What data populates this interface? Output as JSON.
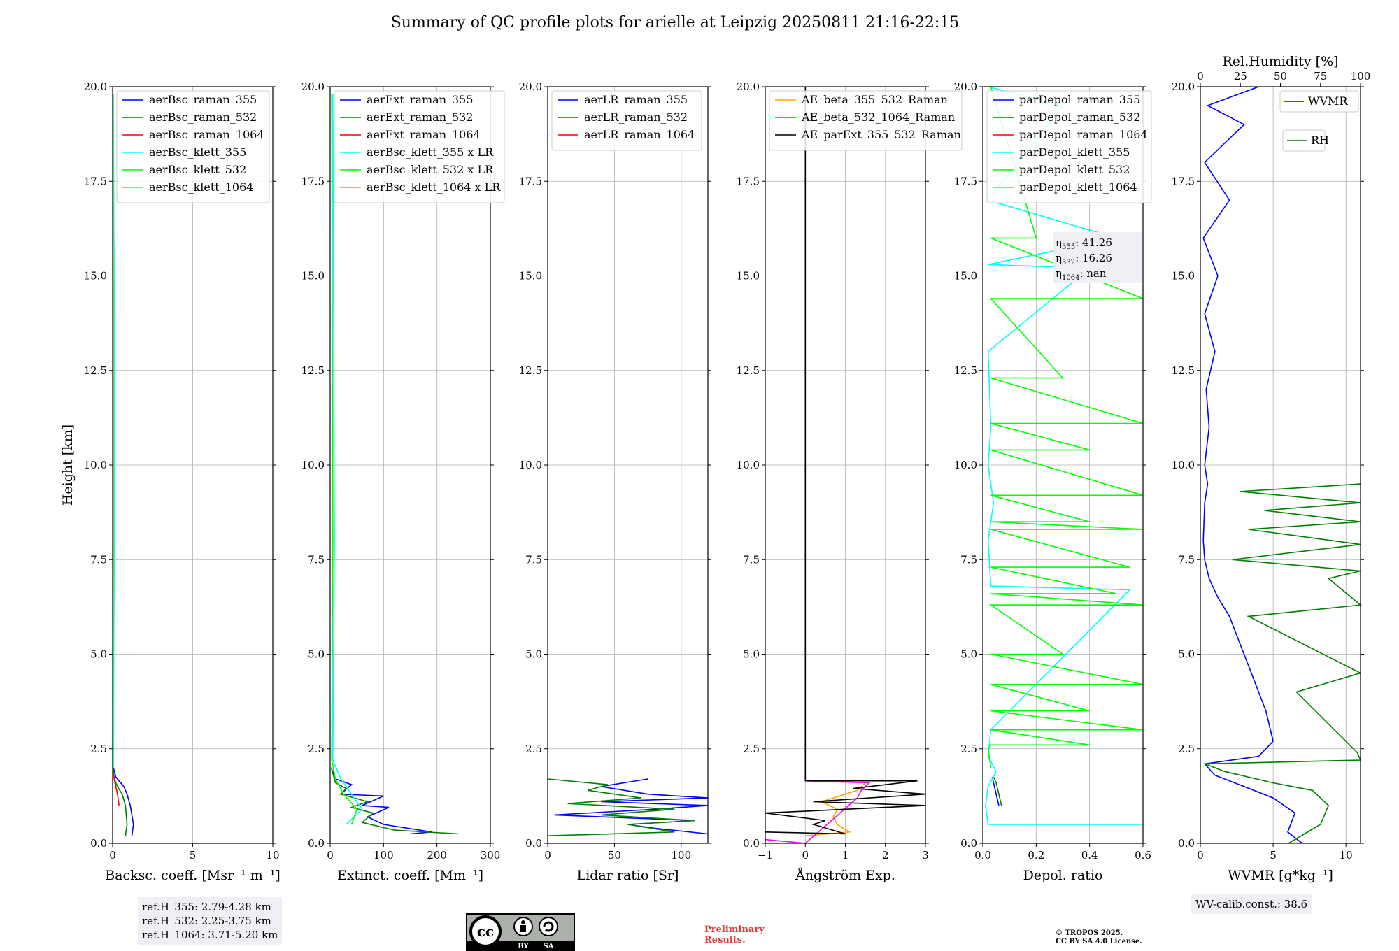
{
  "title": "Summary of QC profile plots for arielle at Leipzig 20250811 21:16-22:15",
  "ylabel": "Height [km]",
  "colors": {
    "blue": "#0000ff",
    "green": "#008000",
    "red": "#ff0000",
    "cyan": "#00ffff",
    "lime": "#00ff00",
    "salmon": "#fa8072",
    "orange": "#ffa500",
    "magenta": "#ff00ff",
    "black": "#000000"
  },
  "bottom_info": {
    "ref_lines": [
      "ref.H_355: 2.79-4.28 km",
      "ref.H_532: 2.25-3.75 km",
      "ref.H_1064: 3.71-5.20 km"
    ],
    "wv_calib": "WV-calib.const.: 38.6",
    "preliminary": [
      "Preliminary",
      "Results."
    ],
    "copyright": [
      "© TROPOS 2025.",
      "CC BY SA 4.0 License."
    ],
    "cc_badge": {
      "left": "BY",
      "right": "SA",
      "main": "cc"
    }
  },
  "chart_data": [
    {
      "type": "line",
      "xlabel": "Backsc. coeff. [Msr⁻¹ m⁻¹]",
      "xlim": [
        0,
        10
      ],
      "ylim": [
        0,
        20
      ],
      "xticks": [
        0,
        5,
        10
      ],
      "xticklabels": [
        "0",
        "5",
        "10"
      ],
      "yticks": [
        0,
        2.5,
        5,
        7.5,
        10,
        12.5,
        15,
        17.5,
        20
      ],
      "yticklabels": [
        "0.0",
        "2.5",
        "5.0",
        "7.5",
        "10.0",
        "12.5",
        "15.0",
        "17.5",
        "20.0"
      ],
      "legend": [
        {
          "name": "aerBsc_raman_355",
          "color": "#0000ff"
        },
        {
          "name": "aerBsc_raman_532",
          "color": "#008000"
        },
        {
          "name": "aerBsc_raman_1064",
          "color": "#ff0000"
        },
        {
          "name": "aerBsc_klett_355",
          "color": "#00ffff"
        },
        {
          "name": "aerBsc_klett_532",
          "color": "#00ff00"
        },
        {
          "name": "aerBsc_klett_1064",
          "color": "#fa8072"
        }
      ],
      "series": [
        {
          "name": "aerBsc_raman_355",
          "color": "#0000ff",
          "x": [
            1.2,
            1.3,
            1.1,
            0.9,
            0.7,
            0.2,
            0.05
          ],
          "y": [
            0.2,
            0.5,
            1.0,
            1.3,
            1.5,
            1.75,
            2.0
          ]
        },
        {
          "name": "aerBsc_raman_532",
          "color": "#008000",
          "x": [
            0.8,
            0.9,
            0.8,
            0.6,
            0.3,
            0.1,
            0.02
          ],
          "y": [
            0.2,
            0.5,
            1.0,
            1.3,
            1.5,
            1.7,
            2.0
          ]
        },
        {
          "name": "aerBsc_raman_1064",
          "color": "#ff0000",
          "x": [
            0.4,
            0.3,
            0.15,
            0.05
          ],
          "y": [
            1.0,
            1.3,
            1.6,
            1.8
          ]
        },
        {
          "name": "aerBsc_klett_355",
          "color": "#00ffff",
          "x": [
            0.05,
            0.1,
            0.1,
            0.05
          ],
          "y": [
            2.0,
            8.0,
            14.0,
            19.8
          ]
        },
        {
          "name": "aerBsc_klett_532",
          "color": "#00ff00",
          "x": [
            0.02,
            0.05,
            0.05,
            0.03
          ],
          "y": [
            2.0,
            8.0,
            14.0,
            19.8
          ]
        },
        {
          "name": "aerBsc_klett_1064",
          "color": "#fa8072",
          "x": [
            0.01,
            0.03,
            0.03,
            0.02
          ],
          "y": [
            2.0,
            8.0,
            14.0,
            19.8
          ]
        }
      ]
    },
    {
      "type": "line",
      "xlabel": "Extinct. coeff. [Mm⁻¹]",
      "xlim": [
        0,
        300
      ],
      "ylim": [
        0,
        20
      ],
      "xticks": [
        0,
        100,
        200,
        300
      ],
      "xticklabels": [
        "0",
        "100",
        "200",
        "300"
      ],
      "yticks": [
        0,
        2.5,
        5,
        7.5,
        10,
        12.5,
        15,
        17.5,
        20
      ],
      "yticklabels": [
        "0.0",
        "2.5",
        "5.0",
        "7.5",
        "10.0",
        "12.5",
        "15.0",
        "17.5",
        "20.0"
      ],
      "legend": [
        {
          "name": "aerExt_raman_355",
          "color": "#0000ff"
        },
        {
          "name": "aerExt_raman_532",
          "color": "#008000"
        },
        {
          "name": "aerExt_raman_1064",
          "color": "#ff0000"
        },
        {
          "name": "aerBsc_klett_355 x LR",
          "color": "#00ffff"
        },
        {
          "name": "aerBsc_klett_532 x LR",
          "color": "#00ff00"
        },
        {
          "name": "aerBsc_klett_1064 x LR",
          "color": "#fa8072"
        }
      ],
      "series": [
        {
          "name": "aerExt_raman_355",
          "color": "#0000ff",
          "x": [
            150,
            190,
            100,
            70,
            110,
            60,
            100,
            20,
            40,
            10,
            2
          ],
          "y": [
            0.25,
            0.3,
            0.5,
            0.7,
            0.95,
            1.0,
            1.25,
            1.3,
            1.55,
            1.7,
            2.0
          ]
        },
        {
          "name": "aerExt_raman_532",
          "color": "#008000",
          "x": [
            240,
            120,
            60,
            80,
            40,
            70,
            20,
            30,
            10,
            2
          ],
          "y": [
            0.25,
            0.35,
            0.55,
            0.8,
            0.95,
            1.1,
            1.3,
            1.45,
            1.6,
            2.0
          ]
        },
        {
          "name": "aerBsc_klett_355 x LR",
          "color": "#00ffff",
          "x": [
            30,
            60,
            40,
            20,
            5,
            8,
            5
          ],
          "y": [
            0.5,
            0.9,
            1.3,
            1.7,
            2.2,
            8.0,
            19.8
          ]
        },
        {
          "name": "aerBsc_klett_532 x LR",
          "color": "#00ff00",
          "x": [
            40,
            50,
            25,
            10,
            3,
            5,
            3
          ],
          "y": [
            0.5,
            0.9,
            1.3,
            1.7,
            2.2,
            8.0,
            19.8
          ]
        }
      ]
    },
    {
      "type": "line",
      "xlabel": "Lidar ratio [Sr]",
      "xlim": [
        0,
        120
      ],
      "ylim": [
        0,
        20
      ],
      "xticks": [
        0,
        50,
        100
      ],
      "xticklabels": [
        "0",
        "50",
        "100"
      ],
      "yticks": [
        0,
        2.5,
        5,
        7.5,
        10,
        12.5,
        15,
        17.5,
        20
      ],
      "yticklabels": [
        "0.0",
        "2.5",
        "5.0",
        "7.5",
        "10.0",
        "12.5",
        "15.0",
        "17.5",
        "20.0"
      ],
      "legend": [
        {
          "name": "aerLR_raman_355",
          "color": "#0000ff"
        },
        {
          "name": "aerLR_raman_532",
          "color": "#008000"
        },
        {
          "name": "aerLR_raman_1064",
          "color": "#ff0000"
        }
      ],
      "series": [
        {
          "name": "aerLR_raman_355",
          "color": "#0000ff",
          "x": [
            120,
            80,
            60,
            110,
            5,
            80,
            120,
            40,
            120,
            75,
            40,
            75
          ],
          "y": [
            0.25,
            0.4,
            0.5,
            0.6,
            0.75,
            0.9,
            1.0,
            1.1,
            1.2,
            1.3,
            1.5,
            1.7
          ]
        },
        {
          "name": "aerLR_raman_532",
          "color": "#008000",
          "x": [
            0,
            95,
            60,
            110,
            40,
            95,
            15,
            70,
            30,
            45,
            0
          ],
          "y": [
            0.2,
            0.3,
            0.5,
            0.6,
            0.75,
            0.9,
            1.05,
            1.2,
            1.4,
            1.55,
            1.7
          ]
        }
      ]
    },
    {
      "type": "line",
      "xlabel": "Ångström Exp.",
      "xlim": [
        -1,
        3
      ],
      "ylim": [
        0,
        20
      ],
      "xticks": [
        -1,
        0,
        1,
        2,
        3
      ],
      "xticklabels": [
        "−1",
        "0",
        "1",
        "2",
        "3"
      ],
      "yticks": [
        0,
        2.5,
        5,
        7.5,
        10,
        12.5,
        15,
        17.5,
        20
      ],
      "yticklabels": [
        "0.0",
        "2.5",
        "5.0",
        "7.5",
        "10.0",
        "12.5",
        "15.0",
        "17.5",
        "20.0"
      ],
      "legend": [
        {
          "name": "AE_beta_355_532_Raman",
          "color": "#ffa500"
        },
        {
          "name": "AE_beta_532_1064_Raman",
          "color": "#ff00ff"
        },
        {
          "name": "AE_parExt_355_532_Raman",
          "color": "#000000"
        }
      ],
      "series": [
        {
          "name": "AE_beta_355_532_Raman",
          "color": "#ffa500",
          "x": [
            0,
            1.1,
            0.8,
            0.7,
            0.8,
            0.4,
            1.0,
            1.3,
            1.5,
            0
          ],
          "y": [
            0.2,
            0.3,
            0.5,
            0.7,
            0.9,
            1.1,
            1.3,
            1.4,
            1.6,
            1.65
          ]
        },
        {
          "name": "AE_beta_532_1064_Raman",
          "color": "#ff00ff",
          "x": [
            -1,
            0,
            0,
            1.3,
            1.4,
            1.6,
            0,
            0
          ],
          "y": [
            0.1,
            0.0,
            0.0,
            1.2,
            1.4,
            1.6,
            1.65,
            20.0
          ]
        },
        {
          "name": "AE_parExt_355_532_Raman",
          "color": "#000000",
          "x": [
            -1,
            1.0,
            0.2,
            0.5,
            -1,
            3.0,
            0.2,
            3.0,
            1.2,
            2.8,
            0,
            0
          ],
          "y": [
            0.3,
            0.25,
            0.5,
            0.6,
            0.8,
            1.0,
            1.1,
            1.3,
            1.45,
            1.65,
            1.65,
            20.0
          ]
        }
      ]
    },
    {
      "type": "line",
      "xlabel": "Depol. ratio",
      "xlim": [
        0,
        0.6
      ],
      "ylim": [
        0,
        20
      ],
      "xticks": [
        0,
        0.2,
        0.4,
        0.6
      ],
      "xticklabels": [
        "0.0",
        "0.2",
        "0.4",
        "0.6"
      ],
      "yticks": [
        0,
        2.5,
        5,
        7.5,
        10,
        12.5,
        15,
        17.5,
        20
      ],
      "yticklabels": [
        "0.0",
        "2.5",
        "5.0",
        "7.5",
        "10.0",
        "12.5",
        "15.0",
        "17.5",
        "20.0"
      ],
      "legend": [
        {
          "name": "parDepol_raman_355",
          "color": "#0000ff"
        },
        {
          "name": "parDepol_raman_532",
          "color": "#008000"
        },
        {
          "name": "parDepol_raman_1064",
          "color": "#ff0000"
        },
        {
          "name": "parDepol_klett_355",
          "color": "#00ffff"
        },
        {
          "name": "parDepol_klett_532",
          "color": "#00ff00"
        },
        {
          "name": "parDepol_klett_1064",
          "color": "#fa8072"
        }
      ],
      "eta": [
        {
          "sub": "355",
          "value": "41.26"
        },
        {
          "sub": "532",
          "value": "16.26"
        },
        {
          "sub": "1064",
          "value": "nan"
        }
      ],
      "series": [
        {
          "name": "parDepol_raman_355",
          "color": "#0000ff",
          "x": [
            0.06,
            0.05,
            0.04,
            0.035
          ],
          "y": [
            1.0,
            1.3,
            1.6,
            1.75
          ]
        },
        {
          "name": "parDepol_raman_532",
          "color": "#008000",
          "x": [
            0.07,
            0.06,
            0.05,
            0.04
          ],
          "y": [
            1.0,
            1.3,
            1.6,
            1.75
          ]
        },
        {
          "name": "parDepol_klett_355",
          "color": "#00ffff",
          "x": [
            0.6,
            0.02,
            0.01,
            0.02,
            0.05,
            0.02,
            0.03,
            0.55,
            0.03,
            0.02,
            0.04,
            0.02,
            0.03,
            0.02,
            0.4,
            0.02,
            0.5,
            0.02,
            0.3,
            0.02
          ],
          "y": [
            0.5,
            0.5,
            1.0,
            1.5,
            1.9,
            2.3,
            3.0,
            6.7,
            6.8,
            8.0,
            9.0,
            10.0,
            11.0,
            13.0,
            15.2,
            15.3,
            16.0,
            17.0,
            19.5,
            20.0
          ]
        },
        {
          "name": "parDepol_klett_532",
          "color": "#00ff00",
          "x": [
            0.03,
            0.02,
            0.03,
            0.4,
            0.03,
            0.6,
            0.03,
            0.4,
            0.03,
            0.6,
            0.03,
            0.3,
            0.03,
            0.6,
            0.03,
            0.5,
            0.03,
            0.55,
            0.03,
            0.6,
            0.03,
            0.4,
            0.03,
            0.6,
            0.03,
            0.4,
            0.03,
            0.6,
            0.03,
            0.3,
            0.03,
            0.6,
            0.03,
            0.2,
            0.03
          ],
          "y": [
            2.0,
            2.5,
            2.6,
            2.6,
            3.0,
            3.0,
            3.5,
            3.5,
            4.2,
            4.2,
            5.0,
            5.0,
            6.3,
            6.3,
            6.6,
            6.6,
            7.3,
            7.3,
            8.3,
            8.3,
            8.5,
            8.5,
            9.2,
            9.2,
            10.4,
            10.4,
            11.1,
            11.1,
            12.3,
            12.3,
            14.4,
            14.4,
            16.0,
            16.0,
            20.0
          ]
        }
      ]
    },
    {
      "type": "line",
      "xlabel": "WVMR [g*kg⁻¹]",
      "x2label": "Rel.Humidity [%]",
      "xlim": [
        0,
        11
      ],
      "x2lim": [
        0,
        100
      ],
      "ylim": [
        0,
        20
      ],
      "xticks": [
        0,
        5,
        10
      ],
      "xticklabels": [
        "0",
        "5",
        "10"
      ],
      "x2ticks": [
        0,
        25,
        50,
        75,
        100
      ],
      "x2ticklabels": [
        "0",
        "25",
        "50",
        "75",
        "100"
      ],
      "yticks": [
        0,
        2.5,
        5,
        7.5,
        10,
        12.5,
        15,
        17.5,
        20
      ],
      "yticklabels": [
        "0.0",
        "2.5",
        "5.0",
        "7.5",
        "10.0",
        "12.5",
        "15.0",
        "17.5",
        "20.0"
      ],
      "legend": [
        {
          "name": "WVMR",
          "color": "#0000ff"
        },
        {
          "name": "RH",
          "color": "#008000"
        }
      ],
      "series": [
        {
          "name": "WVMR",
          "color": "#0000ff",
          "x": [
            7.0,
            6.0,
            6.5,
            5.0,
            3.0,
            1.0,
            0.3,
            4.0,
            5.0,
            4.5,
            3.5,
            2.5,
            2.0,
            1.2,
            0.6,
            0.3,
            0.2,
            0.3,
            0.5,
            0.3,
            0.6,
            0.4,
            1.0,
            0.3,
            1.2,
            0.2,
            2.0,
            0.3,
            3.0,
            0.5,
            4.0
          ],
          "y": [
            0.0,
            0.3,
            0.8,
            1.2,
            1.5,
            1.8,
            2.1,
            2.3,
            2.7,
            3.5,
            4.5,
            5.5,
            6.0,
            6.5,
            7.0,
            7.5,
            8.0,
            9.0,
            9.5,
            10.0,
            11.0,
            12.0,
            13.0,
            14.0,
            15.0,
            16.0,
            17.0,
            18.0,
            19.0,
            19.5,
            20.0
          ]
        },
        {
          "name": "RH",
          "color": "#008000",
          "x": [
            55,
            75,
            80,
            70,
            45,
            15,
            3,
            100,
            98,
            60,
            100,
            30,
            100,
            80,
            100,
            20,
            100,
            30,
            100,
            40,
            100,
            25,
            100
          ],
          "y": [
            0.0,
            0.5,
            1.0,
            1.4,
            1.6,
            1.9,
            2.1,
            2.2,
            2.4,
            4.0,
            4.5,
            6.0,
            6.3,
            7.0,
            7.2,
            7.5,
            7.9,
            8.3,
            8.5,
            8.8,
            9.0,
            9.3,
            9.5
          ]
        }
      ]
    }
  ]
}
